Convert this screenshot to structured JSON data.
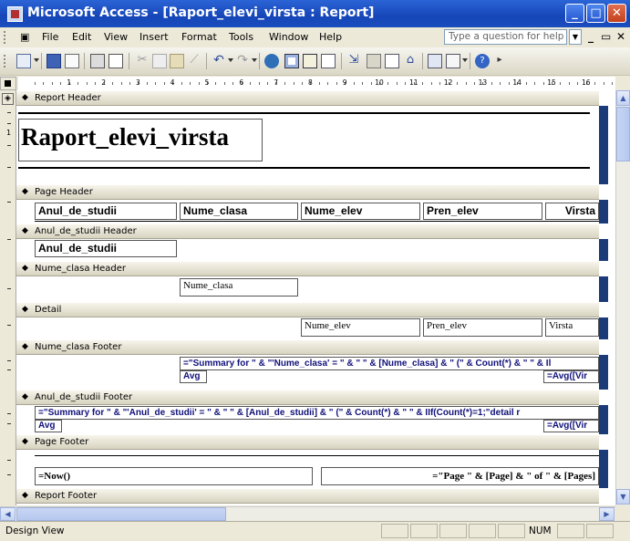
{
  "window": {
    "title": "Microsoft Access - [Raport_elevi_virsta : Report]"
  },
  "menu": {
    "items": [
      "File",
      "Edit",
      "View",
      "Insert",
      "Format",
      "Tools",
      "Window",
      "Help"
    ],
    "help_placeholder": "Type a question for help"
  },
  "ruler": {
    "ticks": [
      "1",
      "2",
      "3",
      "4",
      "5",
      "6",
      "7",
      "8",
      "9",
      "10",
      "11",
      "12",
      "13",
      "14",
      "15",
      "16"
    ]
  },
  "report": {
    "report_header": {
      "band_label": "Report Header",
      "title": "Raport_elevi_virsta"
    },
    "page_header": {
      "band_label": "Page Header",
      "labels": [
        "Anul_de_studii",
        "Nume_clasa",
        "Nume_elev",
        "Pren_elev",
        "Virsta"
      ]
    },
    "anul_header": {
      "band_label": "Anul_de_studii Header",
      "field": "Anul_de_studii"
    },
    "clasa_header": {
      "band_label": "Nume_clasa Header",
      "field": "Nume_clasa"
    },
    "detail": {
      "band_label": "Detail",
      "fields": [
        "Nume_elev",
        "Pren_elev",
        "Virsta"
      ]
    },
    "clasa_footer": {
      "band_label": "Nume_clasa Footer",
      "summary_expr": "=\"Summary for \" & \"'Nume_clasa' = \" & \" \" & [Nume_clasa] & \" (\" & Count(*) & \" \" & Il",
      "avg_label": "Avg",
      "avg_expr": "=Avg([Vir"
    },
    "anul_footer": {
      "band_label": "Anul_de_studii Footer",
      "summary_expr": "=\"Summary for \" & \"'Anul_de_studii' = \" & \" \" & [Anul_de_studii] & \" (\" & Count(*) & \" \" & IIf(Count(*)=1;\"detail r",
      "avg_label": "Avg",
      "avg_expr": "=Avg([Vir"
    },
    "page_footer": {
      "band_label": "Page Footer",
      "now_expr": "=Now()",
      "page_expr": "=\"Page \" & [Page] & \" of \" & [Pages]"
    },
    "report_footer": {
      "band_label": "Report Footer"
    }
  },
  "status_bar": {
    "mode": "Design View",
    "num": "NUM"
  },
  "colors": {
    "titlebar": "#1646b8",
    "band_edge": "#1a3b78"
  }
}
